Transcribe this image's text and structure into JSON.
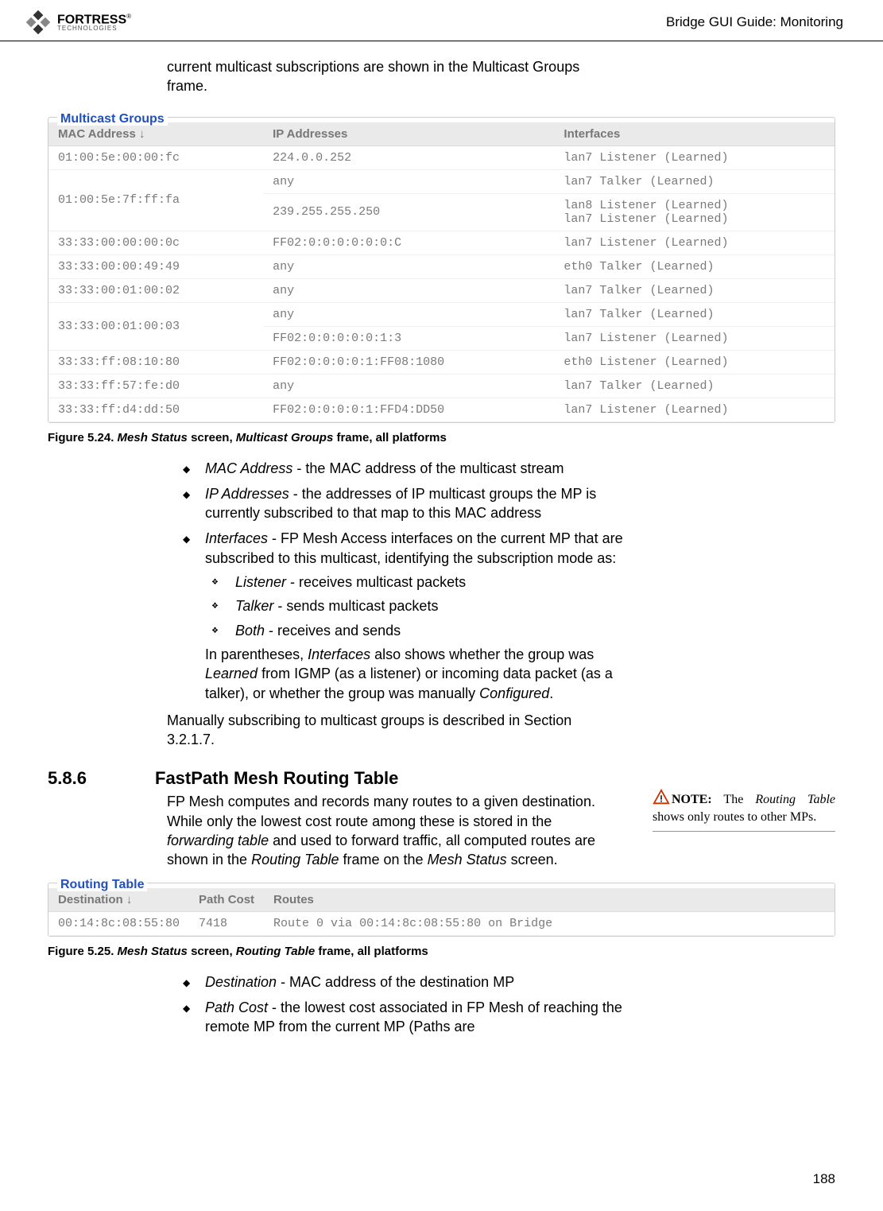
{
  "header": {
    "logo_main": "FORTRESS",
    "logo_sub": "TECHNOLOGIES",
    "tm": "®",
    "right": "Bridge GUI Guide: Monitoring"
  },
  "intro": "current multicast subscriptions are shown in the Multicast Groups frame.",
  "multicast_groups": {
    "title": "Multicast Groups",
    "headers": [
      "MAC Address ↓",
      "IP Addresses",
      "Interfaces"
    ],
    "rows": [
      {
        "mac": "01:00:5e:00:00:fc",
        "sub": [
          {
            "ip": "224.0.0.252",
            "iface": "lan7 Listener (Learned)"
          }
        ]
      },
      {
        "mac": "01:00:5e:7f:ff:fa",
        "sub": [
          {
            "ip": "any",
            "iface": "lan7 Talker (Learned)"
          },
          {
            "ip": "239.255.255.250",
            "iface": "lan8 Listener (Learned)\nlan7 Listener (Learned)"
          }
        ]
      },
      {
        "mac": "33:33:00:00:00:0c",
        "sub": [
          {
            "ip": "FF02:0:0:0:0:0:0:C",
            "iface": "lan7 Listener (Learned)"
          }
        ]
      },
      {
        "mac": "33:33:00:00:49:49",
        "sub": [
          {
            "ip": "any",
            "iface": "eth0 Talker (Learned)"
          }
        ]
      },
      {
        "mac": "33:33:00:01:00:02",
        "sub": [
          {
            "ip": "any",
            "iface": "lan7 Talker (Learned)"
          }
        ]
      },
      {
        "mac": "33:33:00:01:00:03",
        "sub": [
          {
            "ip": "any",
            "iface": "lan7 Talker (Learned)"
          },
          {
            "ip": "FF02:0:0:0:0:0:1:3",
            "iface": "lan7 Listener (Learned)"
          }
        ]
      },
      {
        "mac": "33:33:ff:08:10:80",
        "sub": [
          {
            "ip": "FF02:0:0:0:0:1:FF08:1080",
            "iface": "eth0 Listener (Learned)"
          }
        ]
      },
      {
        "mac": "33:33:ff:57:fe:d0",
        "sub": [
          {
            "ip": "any",
            "iface": "lan7 Talker (Learned)"
          }
        ]
      },
      {
        "mac": "33:33:ff:d4:dd:50",
        "sub": [
          {
            "ip": "FF02:0:0:0:0:1:FFD4:DD50",
            "iface": "lan7 Listener (Learned)"
          }
        ]
      }
    ]
  },
  "figure_524": {
    "prefix": "Figure 5.24. ",
    "p1": "Mesh Status",
    "p2": " screen, ",
    "p3": "Multicast Groups",
    "p4": " frame, all platforms"
  },
  "mg_bullets": {
    "b1_em": "MAC Address",
    "b1_rest": " - the MAC address of the multicast stream",
    "b2_em": "IP Addresses",
    "b2_rest": " - the addresses of IP multicast groups the MP is currently subscribed to that map to this MAC address",
    "b3_em": "Interfaces",
    "b3_rest": " - FP Mesh Access interfaces on the current MP that are subscribed to this multicast, identifying the subscription mode as:",
    "s1_em": "Listener",
    "s1_rest": " - receives multicast packets",
    "s2_em": "Talker",
    "s2_rest": " - sends multicast packets",
    "s3_em": "Both",
    "s3_rest": " - receives and sends",
    "post1a": "In parentheses, ",
    "post1b": "Interfaces",
    "post1c": " also shows whether the group was ",
    "post1d": "Learned",
    "post1e": " from IGMP (as a listener) or incoming data packet (as a talker), or whether the group was manually ",
    "post1f": "Configured",
    "post1g": ".",
    "tail": "Manually subscribing to multicast groups is described in Section 3.2.1.7."
  },
  "section": {
    "num": "5.8.6",
    "title": "FastPath Mesh Routing Table",
    "body_a": "FP Mesh computes and records many routes to a given destination. While only the lowest cost route among these is stored in the ",
    "body_b": "forwarding table",
    "body_c": " and used to forward traffic, all computed routes are shown in the ",
    "body_d": "Routing Table",
    "body_e": " frame on the ",
    "body_f": "Mesh Status",
    "body_g": " screen."
  },
  "note": {
    "label": "NOTE:",
    "a": " The ",
    "b": "Routing Table",
    "c": " shows only routes to other MPs."
  },
  "routing_table": {
    "title": "Routing Table",
    "headers": [
      "Destination ↓",
      "Path Cost",
      "Routes"
    ],
    "row": {
      "dest": "00:14:8c:08:55:80",
      "cost": "7418",
      "route": "Route 0 via 00:14:8c:08:55:80 on Bridge"
    }
  },
  "figure_525": {
    "prefix": "Figure 5.25. ",
    "p1": "Mesh Status",
    "p2": " screen, ",
    "p3": "Routing Table",
    "p4": " frame, all platforms"
  },
  "rt_bullets": {
    "b1_em": "Destination",
    "b1_rest": " - MAC address of the destination MP",
    "b2_em": "Path Cost",
    "b2_rest": " - the lowest cost associated in FP Mesh of reaching the remote MP from the current MP (Paths are"
  },
  "page_num": "188"
}
